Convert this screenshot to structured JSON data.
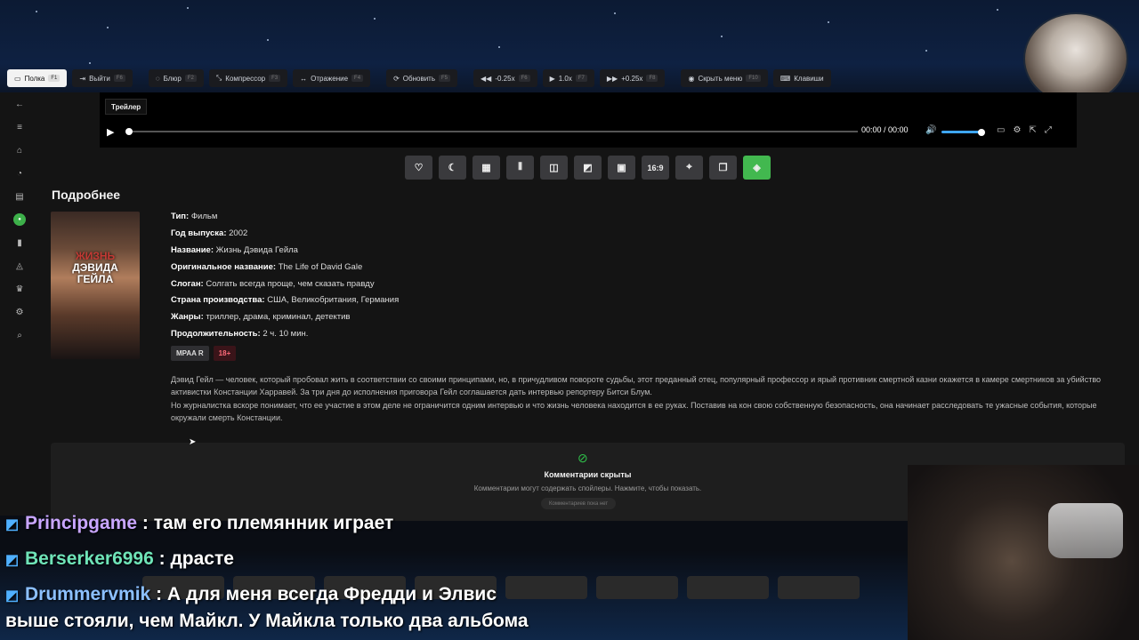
{
  "toolbar": {
    "buttons": [
      {
        "label": "Полка",
        "key": "F1",
        "icon": "shelf-icon"
      },
      {
        "label": "Выйти",
        "key": "F6",
        "icon": "exit-icon"
      },
      {
        "label": "Блюр",
        "key": "F2",
        "icon": "blur-icon"
      },
      {
        "label": "Компрессор",
        "key": "F3",
        "icon": "compressor-icon"
      },
      {
        "label": "Отражение",
        "key": "F4",
        "icon": "mirror-icon"
      },
      {
        "label": "Обновить",
        "key": "F5",
        "icon": "refresh-icon"
      },
      {
        "label": "-0.25x",
        "key": "F6",
        "icon": "rewind-icon"
      },
      {
        "label": "1.0x",
        "key": "F7",
        "icon": "play-icon"
      },
      {
        "label": "+0.25x",
        "key": "F8",
        "icon": "fast-forward-icon"
      },
      {
        "label": "Скрыть меню",
        "key": "F10",
        "icon": "eye-icon"
      },
      {
        "label": "Клавиши",
        "key": "",
        "icon": "keyboard-icon"
      }
    ]
  },
  "player": {
    "trailer_label": "Трейлер",
    "time": "00:00 / 00:00",
    "volume_fraction": 0.85
  },
  "effects": {
    "aspect_label": "16:9"
  },
  "details": {
    "section_title": "Подробнее",
    "poster_title_line1": "ЖИЗНЬ",
    "poster_title_line2": "ДЭВИДА",
    "poster_title_line3": "ГЕЙЛА",
    "rows": [
      {
        "k": "Тип:",
        "v": " Фильм"
      },
      {
        "k": "Год выпуска:",
        "v": " 2002"
      },
      {
        "k": "Название:",
        "v": " Жизнь Дэвида Гейла"
      },
      {
        "k": "Оригинальное название:",
        "v": " The Life of David Gale"
      },
      {
        "k": "Слоган:",
        "v": " Солгать всегда проще, чем сказать правду"
      },
      {
        "k": "Страна производства:",
        "v": " США, Великобритания, Германия"
      },
      {
        "k": "Жанры:",
        "v": " триллер, драма, криминал, детектив"
      },
      {
        "k": "Продолжительность:",
        "v": " 2 ч. 10 мин."
      }
    ],
    "badge_mpaa": "MPAA R",
    "badge_age": "18+",
    "description_p1": "Дэвид Гейл — человек, который пробовал жить в соответствии со своими принципами, но, в причудливом повороте судьбы, этот преданный отец, популярный профессор и ярый противник смертной казни окажется в камере смертников за убийство активистки Констанции Харравей. За три дня до исполнения приговора Гейл соглашается дать интервью репортеру Битси Блум.",
    "description_p2": "Но журналистка вскоре понимает, что ее участие в этом деле не ограничится одним интервью и что жизнь человека находится в ее руках. Поставив на кон свою собственную безопасность, она начинает расследовать те ужасные события, которые окружали смерть Констанции."
  },
  "comments": {
    "title": "Комментарии скрыты",
    "subtitle": "Комментарии могут содержать спойлеры. Нажмите, чтобы показать.",
    "empty": "Комментариев пока нет"
  },
  "chat": [
    {
      "user": "Principgame",
      "text": " : там его племянник играет"
    },
    {
      "user": "Berserker6996",
      "text": " : драсте"
    },
    {
      "user": "Drummervmik",
      "text": " : А для меня всегда Фредди и Элвис"
    },
    {
      "user": "",
      "text": "выше стояли, чем Майкл. У Майкла только два альбома"
    }
  ]
}
